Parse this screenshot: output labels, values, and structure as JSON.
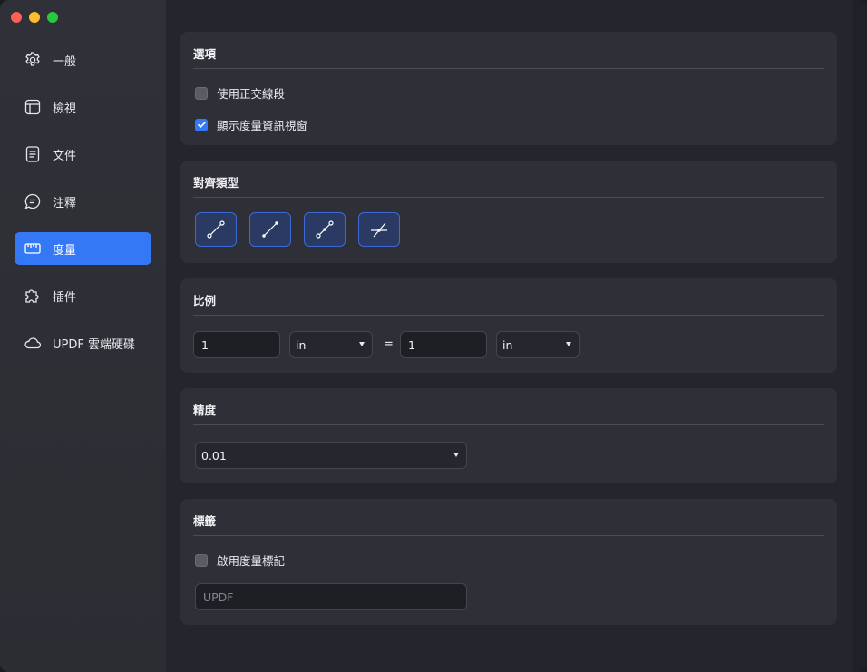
{
  "sidebar": {
    "items": [
      {
        "label": "一般",
        "icon": "gear-icon"
      },
      {
        "label": "檢視",
        "icon": "layout-icon"
      },
      {
        "label": "文件",
        "icon": "document-icon"
      },
      {
        "label": "注釋",
        "icon": "comment-icon"
      },
      {
        "label": "度量",
        "icon": "ruler-icon",
        "active": true
      },
      {
        "label": "插件",
        "icon": "puzzle-icon"
      },
      {
        "label": "UPDF 雲端硬碟",
        "icon": "cloud-icon"
      }
    ]
  },
  "options": {
    "title": "選項",
    "orthogonal_label": "使用正交線段",
    "orthogonal_checked": false,
    "show_window_label": "顯示度量資訊視窗",
    "show_window_checked": true
  },
  "snap": {
    "title": "對齊類型",
    "buttons": [
      "snap-endpoint-icon",
      "snap-path-icon",
      "snap-midpoint-icon",
      "snap-intersection-icon"
    ]
  },
  "scale": {
    "title": "比例",
    "left_value": "1",
    "left_unit": "in",
    "equals": "=",
    "right_value": "1",
    "right_unit": "in"
  },
  "precision": {
    "title": "精度",
    "value": "0.01"
  },
  "labels": {
    "title": "標籤",
    "enable_label": "啟用度量標記",
    "enable_checked": false,
    "text_placeholder": "UPDF"
  },
  "colors": {
    "accent": "#3478f6",
    "sidebar_bg": "#2e2f35",
    "panel_bg": "#2e2f37",
    "content_bg": "#25262d"
  }
}
